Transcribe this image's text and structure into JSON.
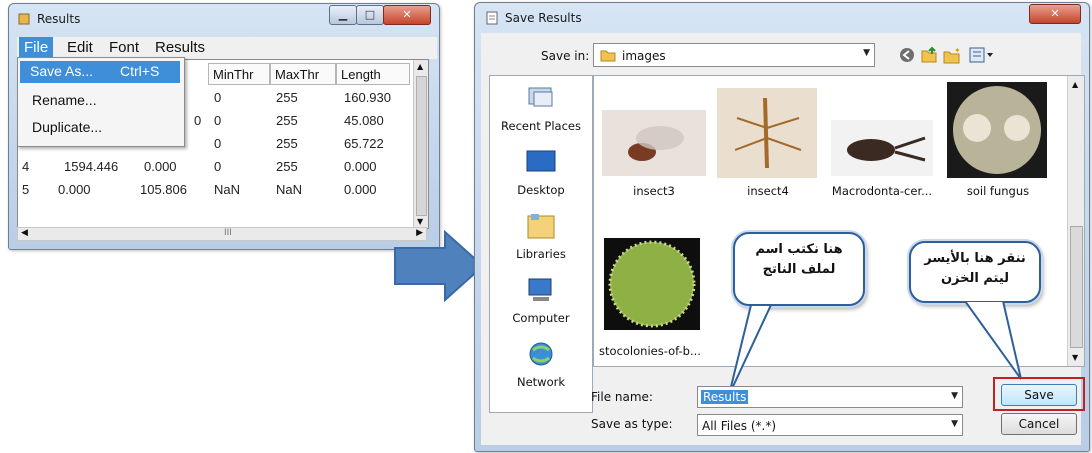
{
  "results_window": {
    "title": "Results",
    "menu": [
      "File",
      "Edit",
      "Font",
      "Results"
    ],
    "file_menu": {
      "items": [
        {
          "label": "Save As...",
          "shortcut": "Ctrl+S"
        },
        {
          "label": "Rename..."
        },
        {
          "label": "Duplicate..."
        }
      ]
    },
    "columns": [
      "MinThr",
      "MaxThr",
      "Length"
    ],
    "rows": [
      {
        "c4": "0",
        "c5": "255",
        "c6": "160.930"
      },
      {
        "c3": "0",
        "c4": "0",
        "c5": "255",
        "c6": "45.080"
      },
      {
        "c4": "0",
        "c5": "255",
        "c6": "65.722"
      },
      {
        "c1": "4",
        "c2": "1594.446",
        "c3": "0.000",
        "c4": "0",
        "c5": "255",
        "c6": "0.000"
      },
      {
        "c1": "5",
        "c2": "0.000",
        "c3": "105.806",
        "c4": "NaN",
        "c5": "NaN",
        "c6": "0.000"
      }
    ],
    "hscroll_mark": "III"
  },
  "save_dialog": {
    "title": "Save Results",
    "save_in_label": "Save in:",
    "folder": "images",
    "places": [
      "Recent Places",
      "Desktop",
      "Libraries",
      "Computer",
      "Network"
    ],
    "files": [
      "insect3",
      "insect4",
      "Macrodonta-cer...",
      "soil fungus",
      "stocolonies-of-b..."
    ],
    "callout_filename": "هنا نكتب اسم لملف الناتج",
    "callout_save": "ننقر هنا بالأيسر ليتم الخزن",
    "file_name_label": "File name:",
    "file_name_value": "Results",
    "save_as_type_label": "Save as type:",
    "save_as_type_value": "All Files (*.*)",
    "save_button": "Save",
    "cancel_button": "Cancel"
  },
  "colors": {
    "highlight": "#3f8ed8",
    "arrow": "#4f81bd",
    "callout_border": "#2d5f9b",
    "save_highlight_box": "#c0221e"
  }
}
